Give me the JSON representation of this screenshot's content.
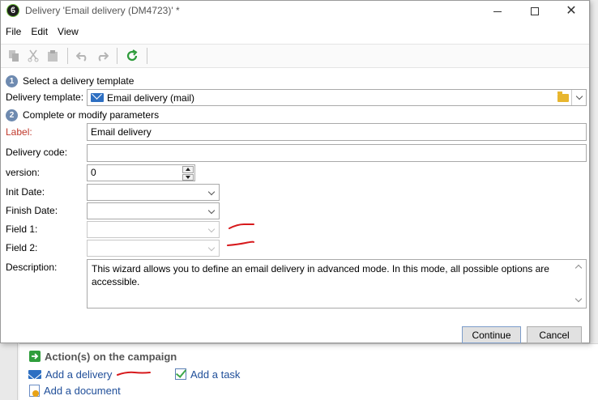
{
  "window": {
    "title": "Delivery 'Email delivery (DM4723)' *",
    "app_icon_glyph": "ϐ"
  },
  "menu": [
    "File",
    "Edit",
    "View"
  ],
  "steps": [
    {
      "number": "1",
      "label": "Select a delivery template"
    },
    {
      "number": "2",
      "label": "Complete or modify parameters"
    }
  ],
  "template": {
    "label": "Delivery template:",
    "value": "Email delivery (mail)"
  },
  "form": {
    "label": {
      "label": "Label:",
      "value": "Email delivery"
    },
    "delivery_code": {
      "label": "Delivery code:",
      "value": ""
    },
    "version": {
      "label": "version:",
      "value": "0"
    },
    "init_date": {
      "label": "Init Date:",
      "value": ""
    },
    "finish_date": {
      "label": "Finish Date:",
      "value": ""
    },
    "field1": {
      "label": "Field 1:",
      "value": ""
    },
    "field2": {
      "label": "Field 2:",
      "value": ""
    },
    "description": {
      "label": "Description:",
      "value": "This wizard allows you to define an email delivery in advanced mode. In this mode, all possible options are accessible."
    }
  },
  "buttons": {
    "continue": "Continue",
    "cancel": "Cancel"
  },
  "background": {
    "heading": "Action(s) on the campaign",
    "links": {
      "add_delivery": "Add a delivery",
      "add_task": "Add a task",
      "add_document": "Add a document"
    }
  },
  "colors": {
    "required_label": "#c0392b",
    "annotation_red": "#d7191c",
    "link_blue": "#1f4e99",
    "step_badge": "#6e8ab0"
  }
}
